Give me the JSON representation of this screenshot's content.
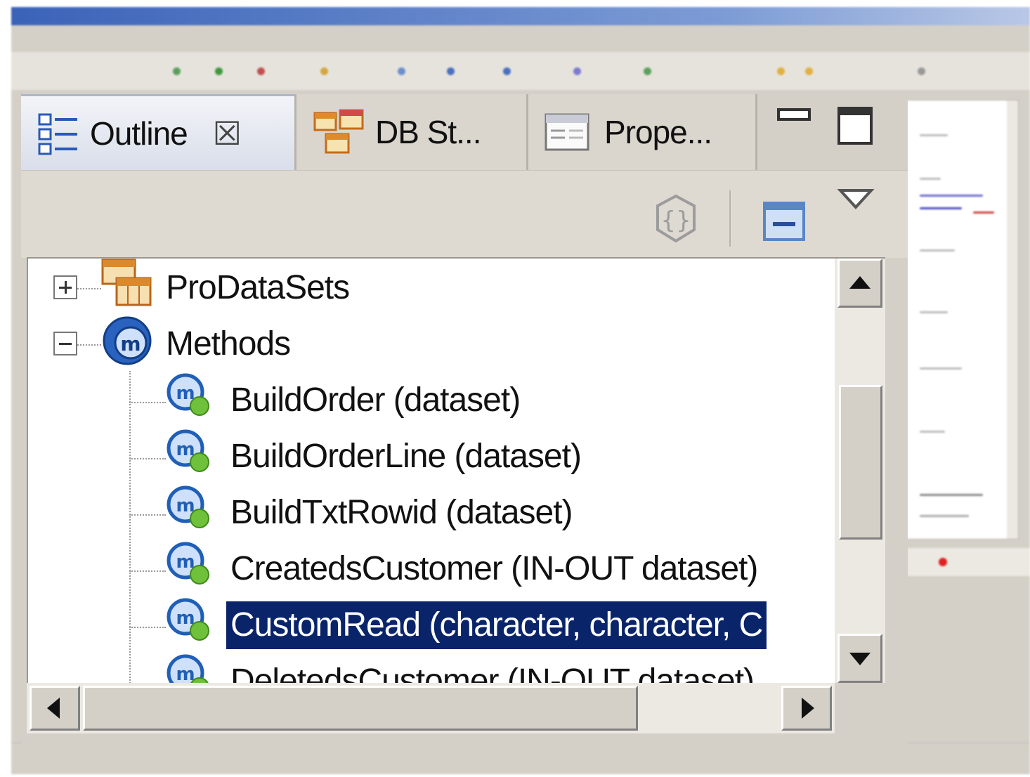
{
  "tabs": [
    {
      "label": "Outline",
      "icon": "outline-icon",
      "active": true
    },
    {
      "label": "DB St...",
      "icon": "db-structure-icon",
      "active": false
    },
    {
      "label": "Prope...",
      "icon": "properties-icon",
      "active": false
    }
  ],
  "tree": {
    "groups": [
      {
        "label": "ProDataSets",
        "expanded": false,
        "icon": "prodatasets-icon"
      },
      {
        "label": "Methods",
        "expanded": true,
        "icon": "methods-icon"
      }
    ],
    "methods": [
      {
        "label": "BuildOrder (dataset)"
      },
      {
        "label": "BuildOrderLine (dataset)"
      },
      {
        "label": "BuildTxtRowid (dataset)"
      },
      {
        "label": "CreatedsCustomer (IN-OUT dataset)"
      },
      {
        "label": "CustomRead (character, character, C",
        "selected": true
      },
      {
        "label": "DeletedsCustomer (IN-OUT dataset)"
      }
    ]
  },
  "colors": {
    "selection_bg": "#0a246a",
    "selection_fg": "#ffffff",
    "method_icon_blue": "#1f5fb8",
    "method_badge_green": "#6fc03a",
    "panel_bg": "#d4d0c8"
  }
}
